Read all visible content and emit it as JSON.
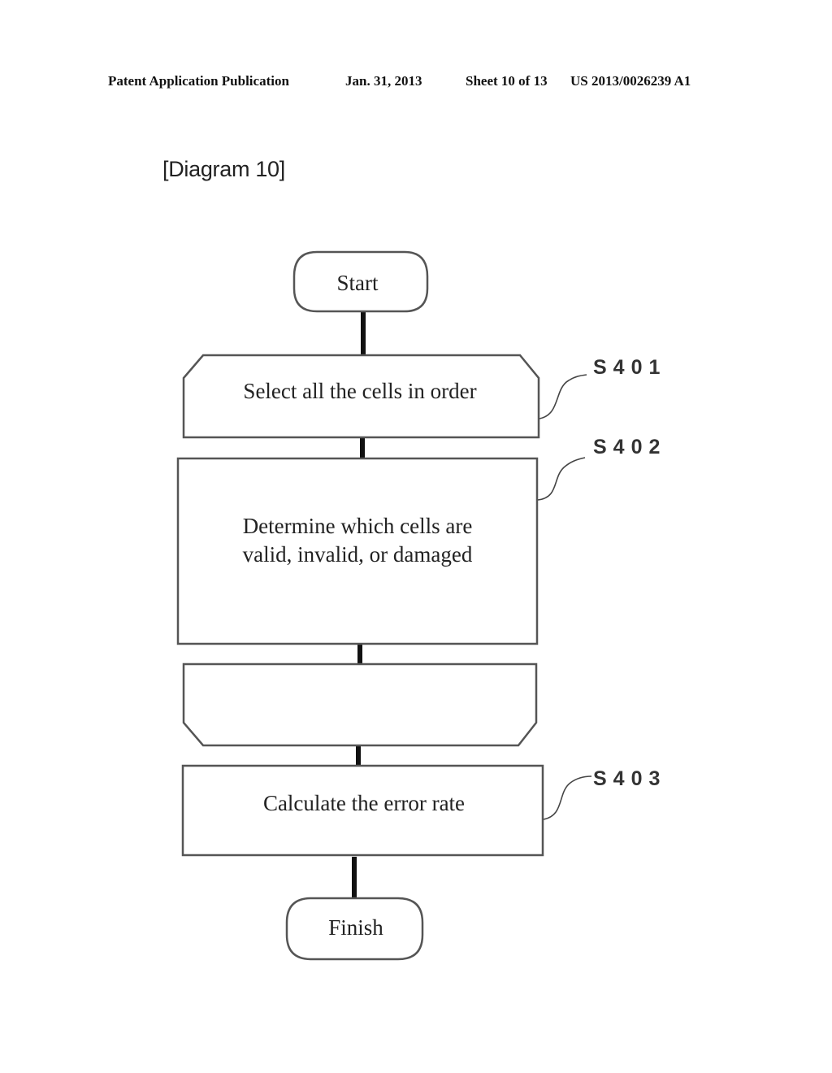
{
  "header": {
    "publication": "Patent Application Publication",
    "date": "Jan. 31, 2013",
    "sheet": "Sheet 10 of 13",
    "number": "US 2013/0026239 A1"
  },
  "figure": {
    "title": "[Diagram 10]"
  },
  "flowchart": {
    "start": "Start",
    "loop_start": {
      "label": "Select all the cells in order",
      "step": "S401"
    },
    "process_determine": {
      "lines": [
        "Determine which cells are",
        "valid, invalid, or damaged"
      ],
      "step": "S402"
    },
    "loop_end": {
      "label": ""
    },
    "process_calculate": {
      "label": "Calculate the error rate",
      "step": "S403"
    },
    "end": "Finish"
  }
}
